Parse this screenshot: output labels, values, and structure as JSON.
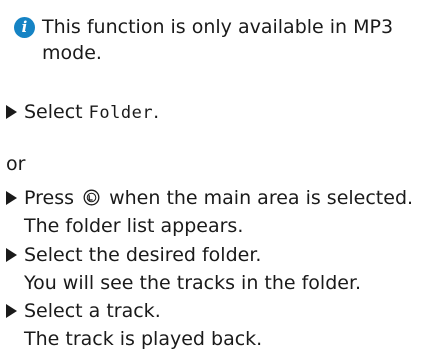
{
  "info": {
    "icon": "info-icon",
    "icon_glyph": "i",
    "accent_color": "#1583c4",
    "line1": "This function is only available in MP3",
    "line2": "mode."
  },
  "steps": [
    {
      "prefix": "Select ",
      "menu_item": "Folder",
      "suffix": "."
    },
    {
      "action_before": "Press ",
      "icon": "controller-press-icon",
      "action_after": " when the main area is selected.",
      "result": "The folder list appears."
    },
    {
      "action": "Select the desired folder.",
      "result": "You will see the tracks in the folder."
    },
    {
      "action": "Select a track.",
      "result": "The track is played back."
    }
  ],
  "connector": "or"
}
